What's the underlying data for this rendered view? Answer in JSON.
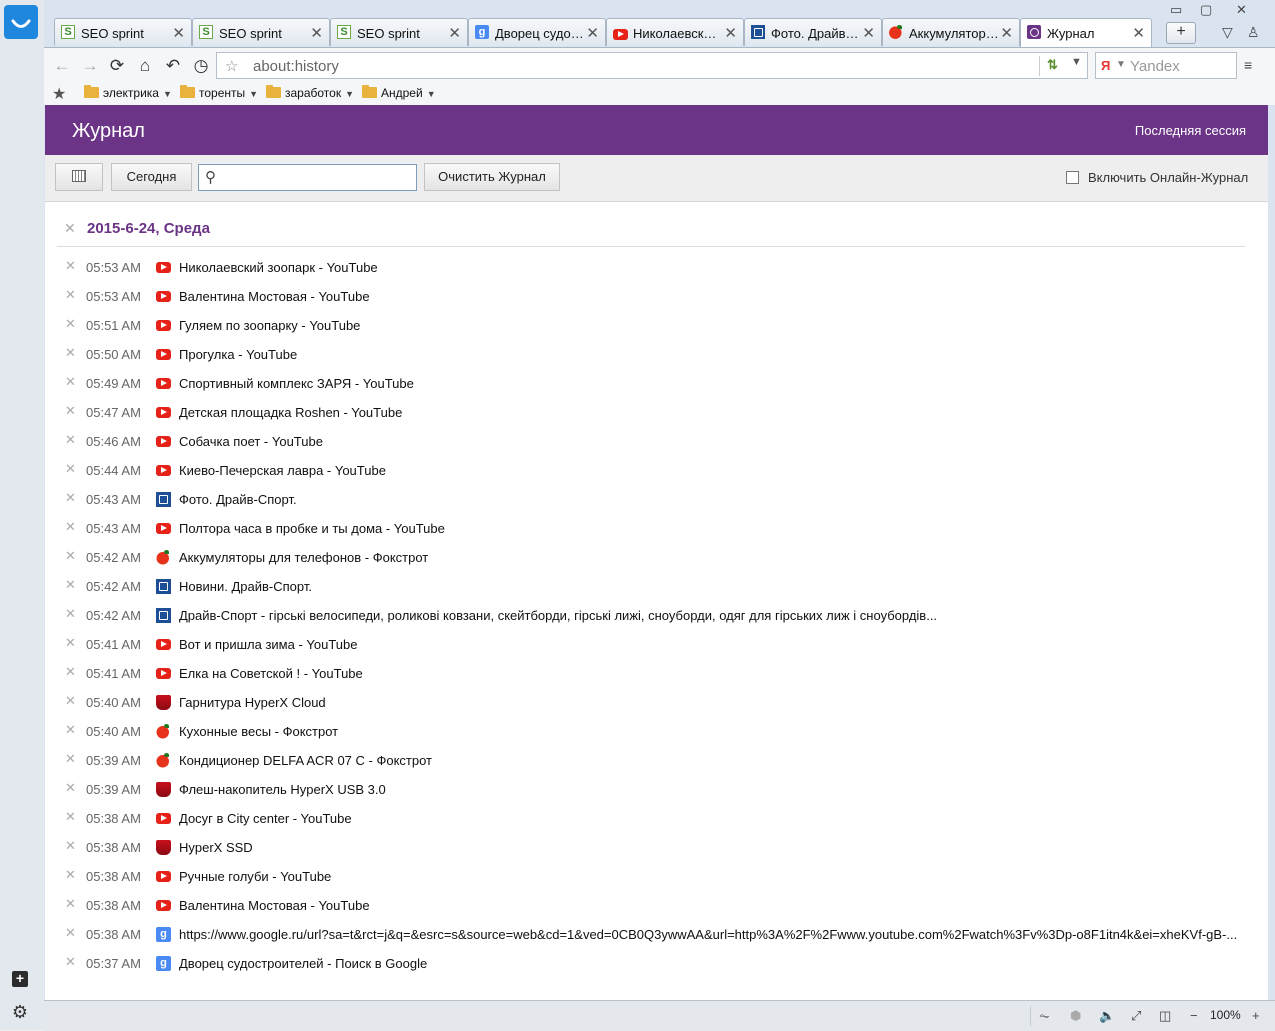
{
  "window": {
    "minimize": "▭",
    "maximize": "▢",
    "close": "✕"
  },
  "tabs": [
    {
      "title": "SEO sprint",
      "icon": "seo-sprint-favicon",
      "active": false
    },
    {
      "title": "SEO sprint",
      "icon": "seo-sprint-favicon",
      "active": false
    },
    {
      "title": "SEO sprint",
      "icon": "seo-sprint-favicon",
      "active": false
    },
    {
      "title": "Дворец судост…",
      "icon": "google-favicon",
      "active": false
    },
    {
      "title": "Николаевск…",
      "icon": "youtube-favicon",
      "active": false
    },
    {
      "title": "Фото. Драйв-…",
      "icon": "drive-sport-favicon",
      "active": false
    },
    {
      "title": "Аккумулятор…",
      "icon": "foxtrot-favicon",
      "active": false
    },
    {
      "title": "Журнал",
      "icon": "history-favicon",
      "active": true
    }
  ],
  "newtab_label": "+",
  "navbar": {
    "url": "about:history",
    "search_engine": "Yandex",
    "search_logo": "Я"
  },
  "bookmarks": [
    {
      "label": "электрика"
    },
    {
      "label": "торенты"
    },
    {
      "label": "заработок"
    },
    {
      "label": "Андрей"
    }
  ],
  "page": {
    "title": "Журнал",
    "last_session": "Последняя сессия",
    "today_button": "Сегодня",
    "search_value": "",
    "clear_button": "Очистить Журнал",
    "online_label": "Включить Онлайн-Журнал",
    "date_heading": "2015-6-24, Среда"
  },
  "entries": [
    {
      "time": "05:53 AM",
      "icon": "youtube",
      "title": "Николаевский зоопарк - YouTube"
    },
    {
      "time": "05:53 AM",
      "icon": "youtube",
      "title": "Валентина Мостовая - YouTube"
    },
    {
      "time": "05:51 AM",
      "icon": "youtube",
      "title": "Гуляем по зоопарку - YouTube"
    },
    {
      "time": "05:50 AM",
      "icon": "youtube",
      "title": "Прогулка - YouTube"
    },
    {
      "time": "05:49 AM",
      "icon": "youtube",
      "title": "Спортивный комплекс ЗАРЯ - YouTube"
    },
    {
      "time": "05:47 AM",
      "icon": "youtube",
      "title": "Детская площадка Roshen - YouTube"
    },
    {
      "time": "05:46 AM",
      "icon": "youtube",
      "title": "Собачка поет - YouTube"
    },
    {
      "time": "05:44 AM",
      "icon": "youtube",
      "title": "Киево-Печерская лавра - YouTube"
    },
    {
      "time": "05:43 AM",
      "icon": "drive-sport",
      "title": "Фото. Драйв-Спорт."
    },
    {
      "time": "05:43 AM",
      "icon": "youtube",
      "title": "Полтора часа в пробке и ты дома - YouTube"
    },
    {
      "time": "05:42 AM",
      "icon": "foxtrot",
      "title": "Аккумуляторы для телефонов - Фокстрот"
    },
    {
      "time": "05:42 AM",
      "icon": "drive-sport",
      "title": "Новини. Драйв-Спорт."
    },
    {
      "time": "05:42 AM",
      "icon": "drive-sport",
      "title": "Драйв-Спорт - гірські велосипеди, роликові ковзани, скейтборди, гірські лижі, сноуборди, одяг для гірських лиж і сноубордів..."
    },
    {
      "time": "05:41 AM",
      "icon": "youtube",
      "title": "Вот и пришла зима - YouTube"
    },
    {
      "time": "05:41 AM",
      "icon": "youtube",
      "title": "Елка на Советской ! - YouTube"
    },
    {
      "time": "05:40 AM",
      "icon": "hyperx",
      "title": "Гарнитура HyperX Cloud"
    },
    {
      "time": "05:40 AM",
      "icon": "foxtrot",
      "title": "Кухонные весы - Фокстрот"
    },
    {
      "time": "05:39 AM",
      "icon": "foxtrot",
      "title": "Кондиционер DELFA ACR 07 C - Фокстрот"
    },
    {
      "time": "05:39 AM",
      "icon": "hyperx",
      "title": "Флеш-накопитель HyperX USB 3.0"
    },
    {
      "time": "05:38 AM",
      "icon": "youtube",
      "title": "Досуг в City center - YouTube"
    },
    {
      "time": "05:38 AM",
      "icon": "hyperx",
      "title": "HyperX SSD"
    },
    {
      "time": "05:38 AM",
      "icon": "youtube",
      "title": "Ручные голуби - YouTube"
    },
    {
      "time": "05:38 AM",
      "icon": "youtube",
      "title": "Валентина Мостовая - YouTube"
    },
    {
      "time": "05:38 AM",
      "icon": "google",
      "title": "https://www.google.ru/url?sa=t&rct=j&q=&esrc=s&source=web&cd=1&ved=0CB0Q3ywwAA&url=http%3A%2F%2Fwww.youtube.com%2Fwatch%3Fv%3Dp-o8F1itn4k&ei=xheKVf-gB-..."
    },
    {
      "time": "05:37 AM",
      "icon": "google",
      "title": "Дворец судостроителей - Поиск в Google"
    }
  ],
  "status": {
    "zoom": "100%",
    "zoom_minus": "−",
    "zoom_plus": "+"
  },
  "colors": {
    "header": "#6b3486",
    "accent": "#6b3486",
    "youtube": "#e62117",
    "google": "#4a8af4",
    "drive_sport": "#1c4f96"
  }
}
